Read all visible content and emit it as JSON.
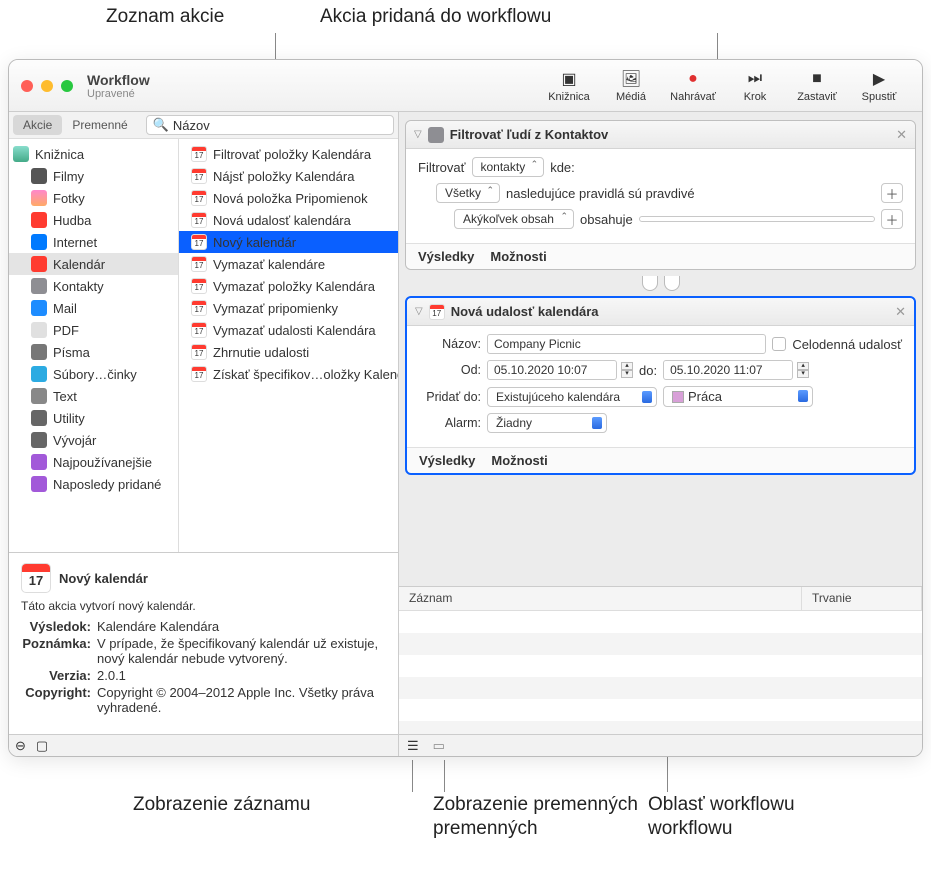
{
  "callouts": {
    "top_left": "Zoznam akcie",
    "top_right": "Akcia pridaná do workflowu",
    "bottom_1": "Zobrazenie záznamu",
    "bottom_2": "Zobrazenie premenných",
    "bottom_3": "Oblasť workflowu"
  },
  "window": {
    "title": "Workflow",
    "subtitle": "Upravené"
  },
  "toolbar": {
    "library": "Knižnica",
    "media": "Médiá",
    "record": "Nahrávať",
    "step": "Krok",
    "stop": "Zastaviť",
    "run": "Spustiť"
  },
  "seg": {
    "actions": "Akcie",
    "variables": "Premenné"
  },
  "search_placeholder": "Názov",
  "library": [
    {
      "icon": "ic-lib",
      "label": "Knižnica"
    },
    {
      "icon": "ic-film",
      "label": "Filmy"
    },
    {
      "icon": "ic-photo",
      "label": "Fotky"
    },
    {
      "icon": "ic-music",
      "label": "Hudba"
    },
    {
      "icon": "ic-net",
      "label": "Internet"
    },
    {
      "icon": "ic-cal",
      "label": "Kalendár",
      "sel": true
    },
    {
      "icon": "ic-con",
      "label": "Kontakty"
    },
    {
      "icon": "ic-mail",
      "label": "Mail"
    },
    {
      "icon": "ic-pdf",
      "label": "PDF"
    },
    {
      "icon": "ic-font",
      "label": "Písma"
    },
    {
      "icon": "ic-files",
      "label": "Súbory…činky"
    },
    {
      "icon": "ic-text",
      "label": "Text"
    },
    {
      "icon": "ic-util",
      "label": "Utility"
    },
    {
      "icon": "ic-dev",
      "label": "Vývojár"
    },
    {
      "icon": "ic-pop",
      "label": "Najpoužívanejšie"
    },
    {
      "icon": "ic-recent",
      "label": "Naposledy pridané"
    }
  ],
  "actions_list": [
    "Filtrovať položky Kalendára",
    "Nájsť položky Kalendára",
    "Nová položka Pripomienok",
    "Nová udalosť kalendára",
    "Nový kalendár",
    "Vymazať kalendáre",
    "Vymazať položky Kalendára",
    "Vymazať pripomienky",
    "Vymazať udalosti Kalendára",
    "Zhrnutie udalosti",
    "Získať špecifikov…oložky Kalendára"
  ],
  "actions_selected_index": 4,
  "info": {
    "title": "Nový kalendár",
    "desc": "Táto akcia vytvorí nový kalendár.",
    "k_result": "Výsledok:",
    "v_result": "Kalendáre Kalendára",
    "k_note": "Poznámka:",
    "v_note": "V prípade, že špecifikovaný kalendár už existuje, nový kalendár nebude vytvorený.",
    "k_ver": "Verzia:",
    "v_ver": "2.0.1",
    "k_copy": "Copyright:",
    "v_copy": "Copyright © 2004–2012 Apple Inc. Všetky práva vyhradené."
  },
  "action1": {
    "title": "Filtrovať ľudí z Kontaktov",
    "filter_label": "Filtrovať",
    "filter_val": "kontakty",
    "where": "kde:",
    "all": "Všetky",
    "rules_text": "nasledujúce pravidlá sú pravdivé",
    "anycontent": "Akýkoľvek obsah",
    "contains": "obsahuje",
    "results": "Výsledky",
    "options": "Možnosti"
  },
  "action2": {
    "title": "Nová udalosť kalendára",
    "name_label": "Názov:",
    "name_val": "Company Picnic",
    "allday": "Celodenná udalosť",
    "from_label": "Od:",
    "from_val": "05.10.2020 10:07",
    "to_label": "do:",
    "to_val": "05.10.2020 11:07",
    "addto_label": "Pridať do:",
    "addto_val": "Existujúceho kalendára",
    "cal_val": "Práca",
    "alarm_label": "Alarm:",
    "alarm_val": "Žiadny",
    "results": "Výsledky",
    "options": "Možnosti"
  },
  "log": {
    "col1": "Záznam",
    "col2": "Trvanie"
  }
}
